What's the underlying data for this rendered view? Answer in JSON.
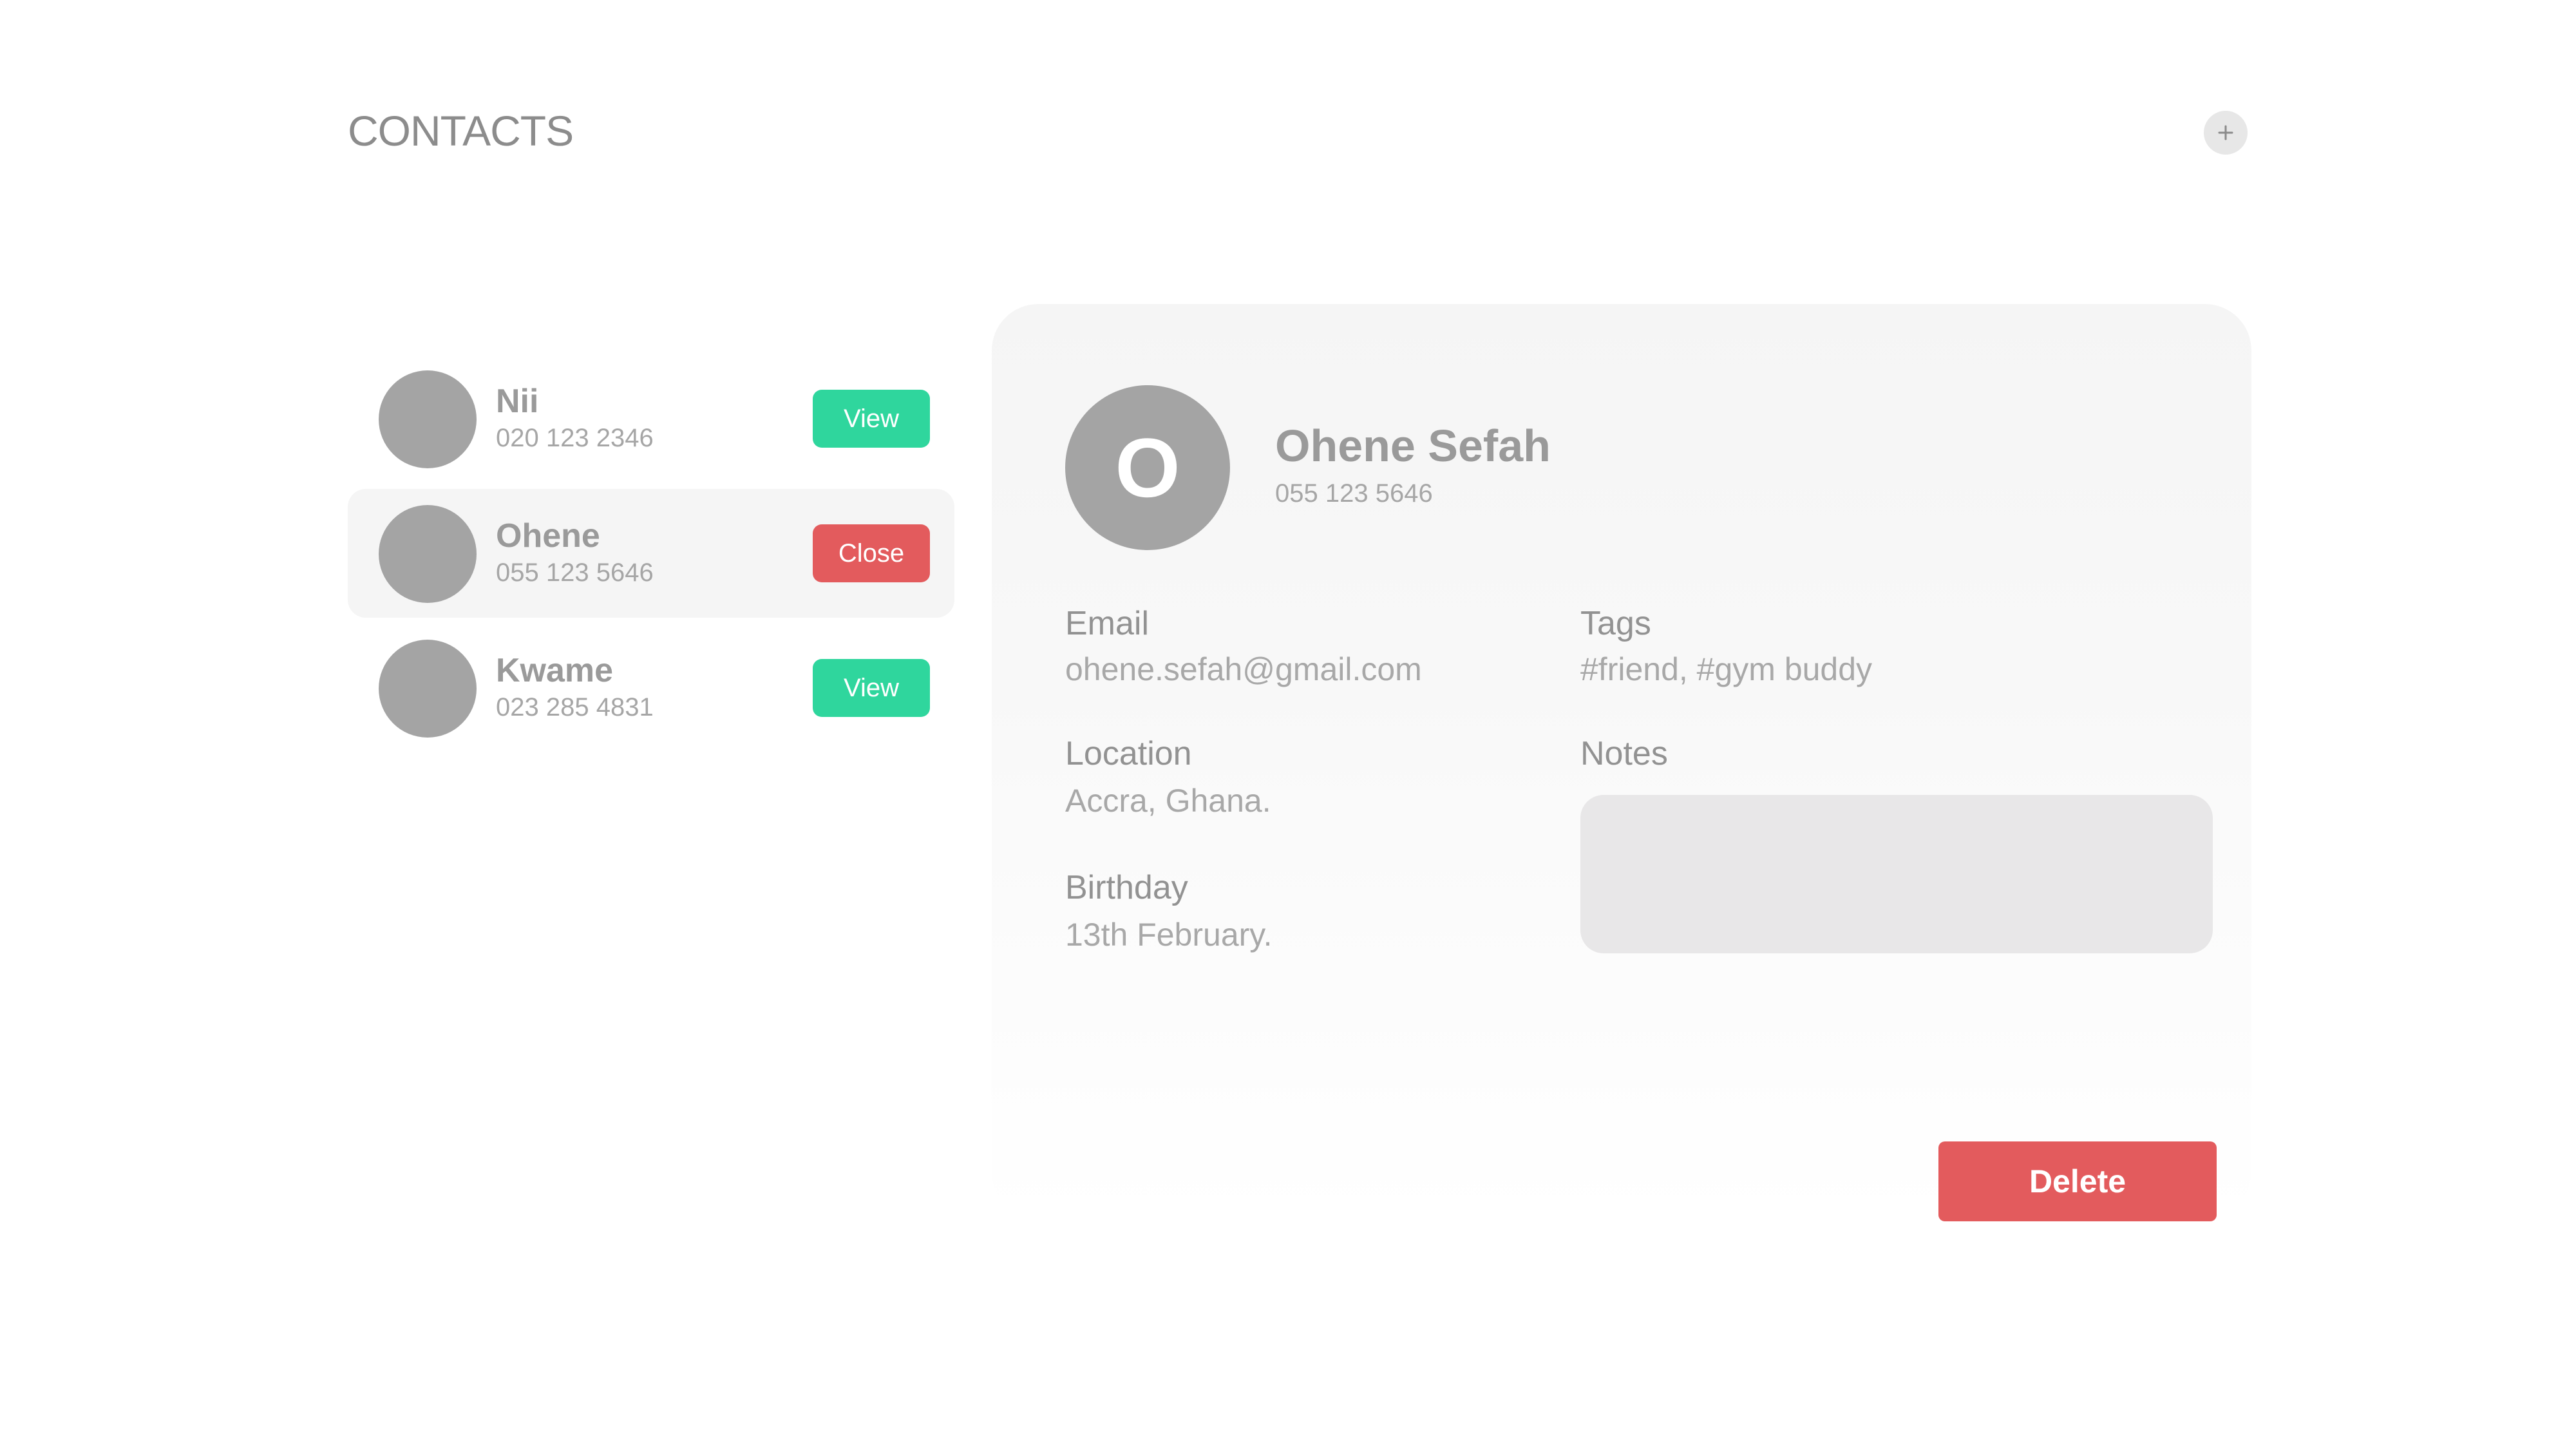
{
  "header": {
    "title": "CONTACTS",
    "add_icon": "plus-icon"
  },
  "contacts": [
    {
      "name": "Nii",
      "phone": "020 123 2346",
      "action": "View"
    },
    {
      "name": "Ohene",
      "phone": "055 123 5646",
      "action": "Close"
    },
    {
      "name": "Kwame",
      "phone": "023 285 4831",
      "action": "View"
    }
  ],
  "selected_index": 1,
  "detail": {
    "initial": "O",
    "full_name": "Ohene Sefah",
    "phone": "055 123 5646",
    "email_label": "Email",
    "email": "ohene.sefah@gmail.com",
    "tags_label": "Tags",
    "tags": "#friend, #gym buddy",
    "location_label": "Location",
    "location": "Accra, Ghana.",
    "notes_label": "Notes",
    "notes": "",
    "birthday_label": "Birthday",
    "birthday": "13th February.",
    "delete_label": "Delete"
  },
  "colors": {
    "view_button": "#2fd69d",
    "close_button": "#e35b5d",
    "delete_button": "#e35b5d",
    "avatar": "#a4a4a4"
  }
}
